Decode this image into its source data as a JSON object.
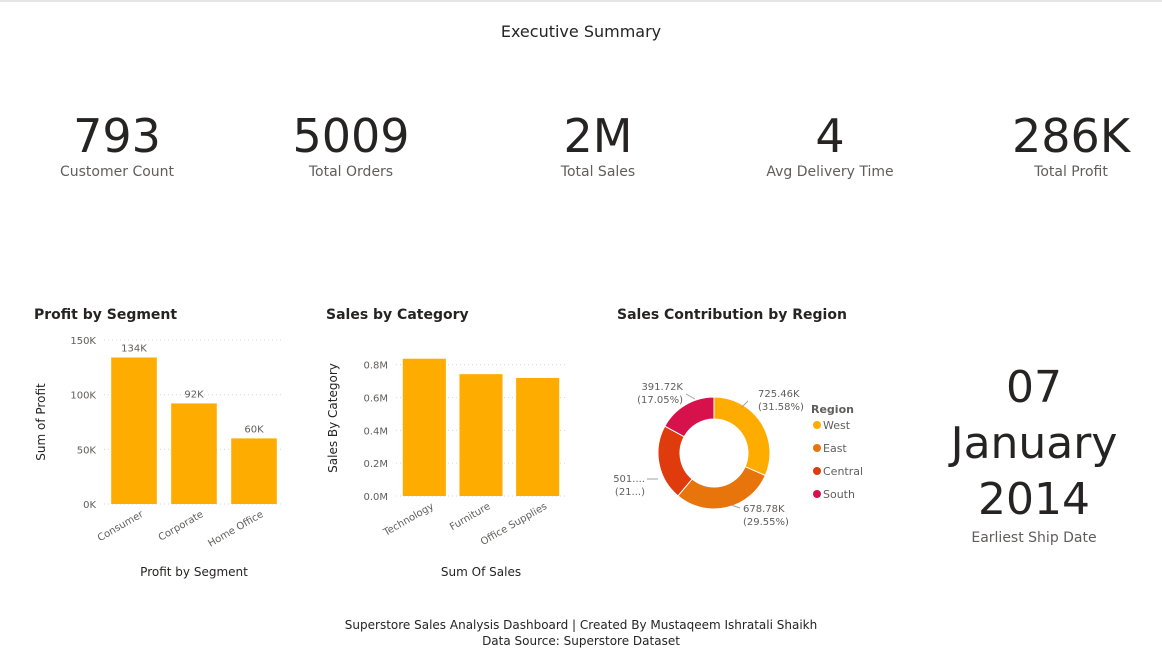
{
  "report": {
    "title": "Executive Summary"
  },
  "kpis": [
    {
      "value": "793",
      "label": "Customer Count"
    },
    {
      "value": "5009",
      "label": "Total Orders"
    },
    {
      "value": "2M",
      "label": "Total Sales"
    },
    {
      "value": "4",
      "label": "Avg Delivery Time"
    },
    {
      "value": "286K",
      "label": "Total Profit"
    }
  ],
  "date_card": {
    "day": "07",
    "month": "January",
    "year": "2014",
    "label": "Earliest Ship Date"
  },
  "footer": {
    "line1": "Superstore Sales Analysis Dashboard |  Created By Mustaqeem Ishratali Shaikh",
    "line2": "Data Source: Superstore Dataset"
  },
  "colors": {
    "bar": "#FFAC00",
    "west": "#FFAC00",
    "east": "#E8740C",
    "central": "#DF3B0C",
    "south": "#D6114C",
    "text": "#252423",
    "muted": "#605e5c"
  },
  "chart_data": [
    {
      "id": "profit",
      "type": "bar",
      "title": "Profit by Segment",
      "xlabel": "Profit by Segment",
      "ylabel": "Sum of Profit",
      "categories": [
        "Consumer",
        "Corporate",
        "Home Office"
      ],
      "values": [
        134000,
        92000,
        60000
      ],
      "data_labels": [
        "134K",
        "92K",
        "60K"
      ],
      "yticks": [
        0,
        50000,
        100000,
        150000
      ],
      "ytick_labels": [
        "0K",
        "50K",
        "100K",
        "150K"
      ],
      "ylim": [
        0,
        150000
      ],
      "grid": true
    },
    {
      "id": "sales",
      "type": "bar",
      "title": "Sales by Category",
      "xlabel": "Sum Of Sales",
      "ylabel": "Sales By Category",
      "categories": [
        "Technology",
        "Furniture",
        "Office Supplies"
      ],
      "values": [
        836000,
        742000,
        719000
      ],
      "yticks": [
        0,
        200000,
        400000,
        600000,
        800000
      ],
      "ytick_labels": [
        "0.0M",
        "0.2M",
        "0.4M",
        "0.6M",
        "0.8M"
      ],
      "ylim": [
        0,
        950000
      ],
      "grid": true
    },
    {
      "id": "region",
      "type": "pie",
      "title": "Sales Contribution by Region",
      "legend_title": "Region",
      "legend_position": "right",
      "categories": [
        "West",
        "East",
        "Central",
        "South"
      ],
      "values": [
        725.46,
        678.78,
        501.24,
        391.72
      ],
      "labels": [
        [
          "725.46K",
          "(31.58%)"
        ],
        [
          "678.78K",
          "(29.55%)"
        ],
        [
          "501....",
          "(21...)"
        ],
        [
          "391.72K",
          "(17.05%)"
        ]
      ]
    }
  ]
}
